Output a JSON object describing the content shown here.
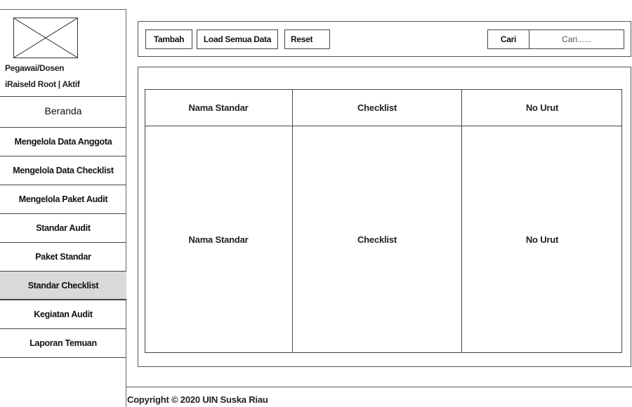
{
  "sidebar": {
    "user_role": "Pegawai/Dosen",
    "user_status": "iRaiseld Root  |  Aktif",
    "home_label": "Beranda",
    "items": [
      {
        "label": "Mengelola Data Anggota"
      },
      {
        "label": "Mengelola Data Checklist"
      },
      {
        "label": "Mengelola Paket Audit"
      },
      {
        "label": "Standar Audit"
      },
      {
        "label": "Paket Standar"
      },
      {
        "label": "Standar Checklist",
        "active": true
      },
      {
        "label": "Kegiatan Audit"
      },
      {
        "label": "Laporan Temuan"
      }
    ]
  },
  "toolbar": {
    "add_label": "Tambah",
    "load_all_label": "Load Semua Data",
    "reset_label": "Reset",
    "search_label": "Cari",
    "search_placeholder": "Cari......"
  },
  "table": {
    "columns": [
      "Nama Standar",
      "Checklist",
      "No Urut"
    ],
    "rows": [
      [
        "Nama Standar",
        "Checklist",
        "No Urut"
      ]
    ]
  },
  "footer": {
    "copyright": "Copyright © 2020 UIN Suska Riau"
  },
  "colors": {
    "active_menu_bg": "#d9d9d9",
    "border": "#444444"
  }
}
